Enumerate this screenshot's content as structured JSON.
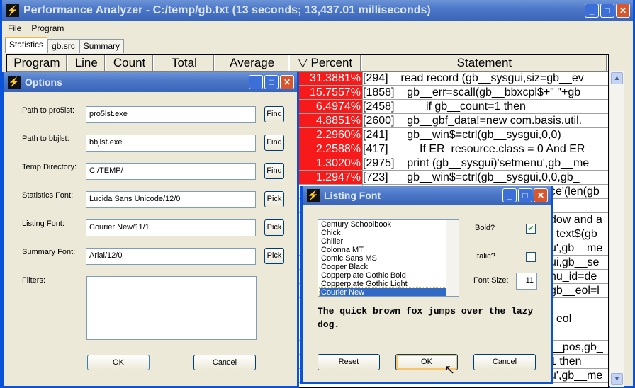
{
  "main": {
    "title": "Performance Analyzer - C:/temp/gb.txt (13 seconds; 13,437.01 milliseconds)",
    "menu": [
      "File",
      "Program"
    ],
    "tabs": [
      "Statistics",
      "gb.src",
      "Summary"
    ],
    "columns": [
      "Program",
      "Line",
      "Count",
      "Total",
      "Average",
      "Percent",
      "Statement"
    ],
    "sort_icon": "▽",
    "rows": [
      {
        "percent": "31.3881%",
        "statement": "[294]    read record (gb__sysgui,siz=gb__ev"
      },
      {
        "percent": "15.7557%",
        "statement": "[1858]    gb__err=scall(gb__bbxcpl$+\" \"+gb"
      },
      {
        "percent": "6.4974%",
        "statement": "[2458]          if gb__count=1 then"
      },
      {
        "percent": "4.8851%",
        "statement": "[2600]    gb__gbf_data!=new com.basis.util."
      },
      {
        "percent": "2.2960%",
        "statement": "[241]      gb__win$=ctrl(gb__sysgui,0,0)"
      },
      {
        "percent": "2.2588%",
        "statement": "[417]          If ER_resource.class = 0 And ER_"
      },
      {
        "percent": "1.3020%",
        "statement": "[2975]    print (gb__sysgui)'setmenu',gb__me"
      },
      {
        "percent": "1.2947%",
        "statement": "[723]      gb__win$=ctrl(gb__sysgui,0,0,gb_"
      },
      {
        "percent": "",
        "statement": "ce'(len(gb"
      },
      {
        "percent": "",
        "statement": ""
      },
      {
        "percent": "",
        "statement": "dow and a"
      },
      {
        "percent": "",
        "statement": "_text$(gb"
      },
      {
        "percent": "",
        "statement": "u',gb__me"
      },
      {
        "percent": "",
        "statement": "ui,gb__se"
      },
      {
        "percent": "",
        "statement": "nu_id=de"
      },
      {
        "percent": "",
        "statement": "gb__eol=l"
      },
      {
        "percent": "",
        "statement": ""
      },
      {
        "percent": "",
        "statement": "_eol"
      },
      {
        "percent": "",
        "statement": ""
      },
      {
        "percent": "",
        "statement": "__pos,gb_"
      },
      {
        "percent": "",
        "statement": "1 then"
      },
      {
        "percent": "",
        "statement": "u',gb__me"
      }
    ]
  },
  "options": {
    "title": "Options",
    "fields": [
      {
        "label": "Path to pro5lst:",
        "value": "pro5lst.exe",
        "button": "Find"
      },
      {
        "label": "Path to bbjlst:",
        "value": "bbjlst.exe",
        "button": "Find"
      },
      {
        "label": "Temp Directory:",
        "value": "C:/TEMP/",
        "button": "Find"
      },
      {
        "label": "Statistics Font:",
        "value": "Lucida Sans Unicode/12/0",
        "button": "Pick"
      },
      {
        "label": "Listing Font:",
        "value": "Courier New/11/1",
        "button": "Pick"
      },
      {
        "label": "Summary Font:",
        "value": "Arial/12/0",
        "button": "Pick"
      }
    ],
    "filters_label": "Filters:",
    "filters_value": "",
    "ok": "OK",
    "cancel": "Cancel"
  },
  "font": {
    "title": "Listing Font",
    "fonts": [
      "Century Schoolbook",
      "Chick",
      "Chiller",
      "Colonna MT",
      "Comic Sans MS",
      "Cooper Black",
      "Copperplate Gothic Bold",
      "Copperplate Gothic Light",
      "Courier New"
    ],
    "selected": "Courier New",
    "bold_label": "Bold?",
    "bold": true,
    "italic_label": "Italic?",
    "italic": false,
    "size_label": "Font Size:",
    "size": "11",
    "preview": "The quick brown fox jumps over the lazy dog.",
    "reset": "Reset",
    "ok": "OK",
    "cancel": "Cancel"
  }
}
